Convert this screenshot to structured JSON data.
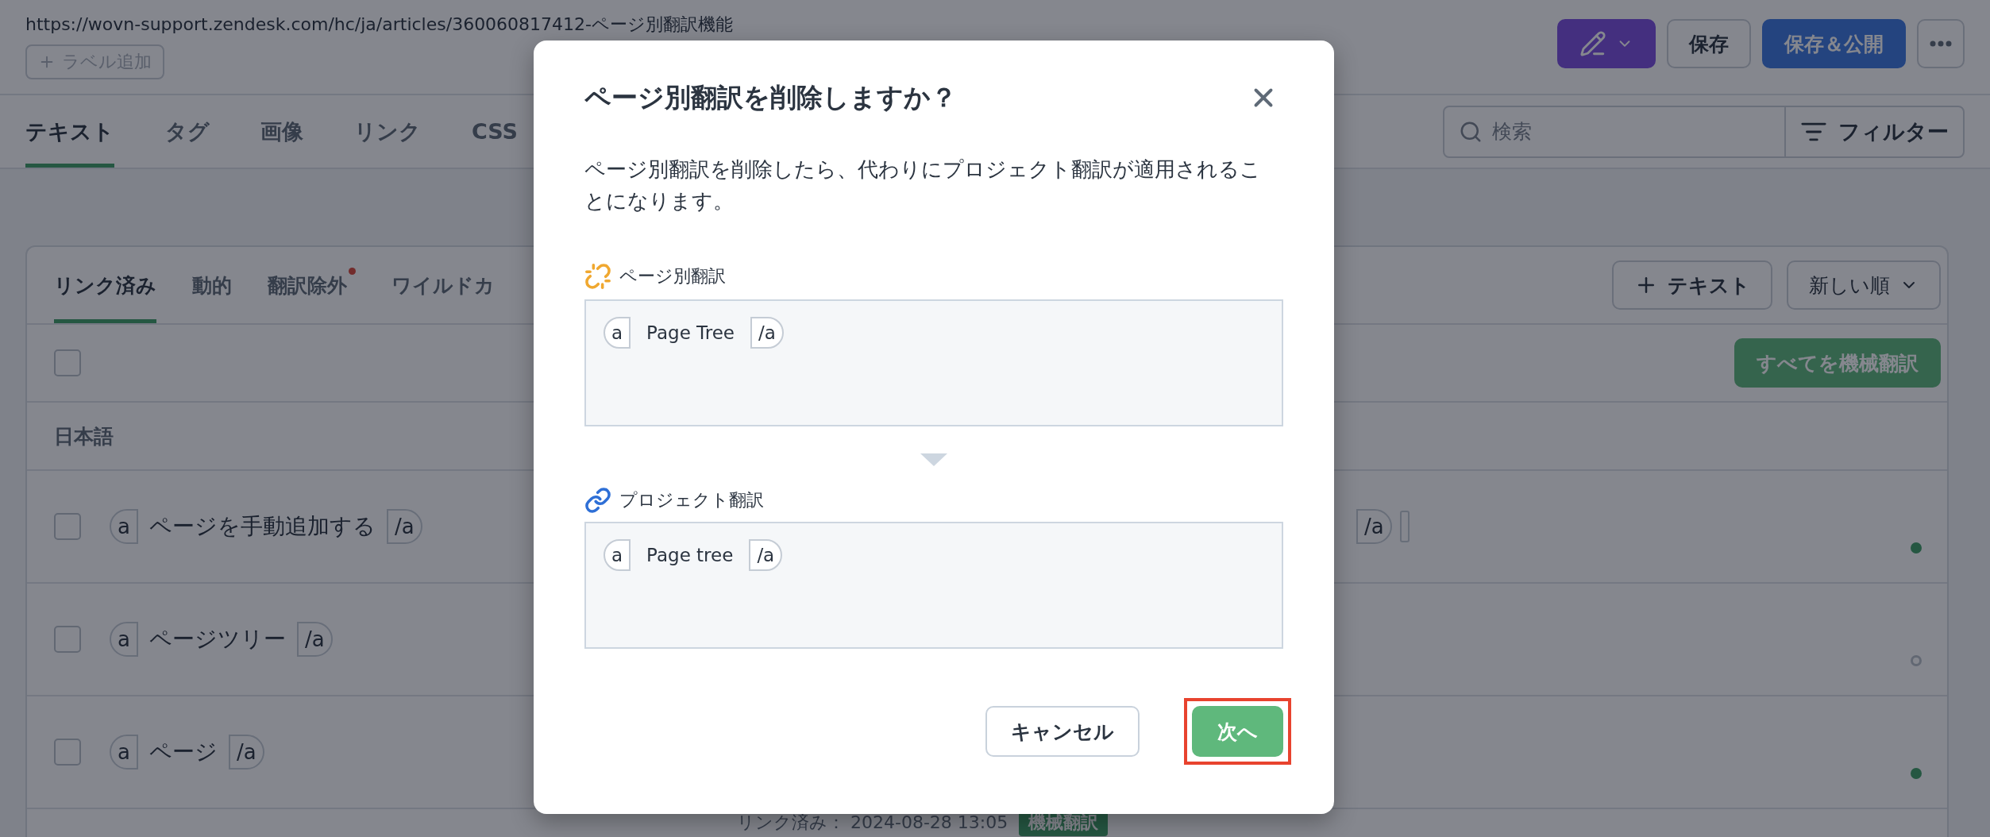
{
  "page": {
    "url": "https://wovn-support.zendesk.com/hc/ja/articles/360060817412-ページ別翻訳機能",
    "add_label_button": "ラベル追加",
    "toolbar": {
      "save_button": "保存",
      "publish_button": "保存＆公開"
    },
    "tabs": [
      {
        "label": "テキスト",
        "selected": true
      },
      {
        "label": "タグ",
        "selected": false
      },
      {
        "label": "画像",
        "selected": false
      },
      {
        "label": "リンク",
        "selected": false
      },
      {
        "label": "CSS",
        "selected": false
      }
    ],
    "search": {
      "placeholder": "検索"
    },
    "filter_button": "フィルター",
    "card": {
      "tabs": [
        {
          "label": "リンク済み",
          "selected": true,
          "badge": false
        },
        {
          "label": "動的",
          "selected": false,
          "badge": false
        },
        {
          "label": "翻訳除外",
          "selected": false,
          "badge": true
        },
        {
          "label": "ワイルドカ",
          "selected": false,
          "badge": false
        }
      ],
      "add_text_button": "テキスト",
      "sort": "新しい順",
      "machine_translate_all_button": "すべてを機械翻訳",
      "select_all_checked": false,
      "language": "日本語",
      "rows": [
        {
          "checked": false,
          "open_tag": "a",
          "source": "ページを手動追加する",
          "close_tag": "/a",
          "translation_tail": "/a",
          "done": true
        },
        {
          "checked": false,
          "open_tag": "a",
          "source": "ページツリー",
          "close_tag": "/a",
          "done": false
        },
        {
          "checked": false,
          "open_tag": "a",
          "source": "ページ",
          "close_tag": "/a",
          "done": true
        }
      ],
      "last_row": {
        "meta": "リンク済み： 2024-08-28 13:05",
        "tag": "機械翻訳"
      }
    }
  },
  "dialog": {
    "title": "ページ別翻訳を削除しますか？",
    "message": "ページ別翻訳を削除したら、代わりにプロジェクト翻訳が適用されることになります。",
    "sections": [
      {
        "kind": "page",
        "label": "ページ別翻訳",
        "open_tag": "a",
        "text": "Page Tree",
        "close_tag": "/a"
      },
      {
        "kind": "project",
        "label": "プロジェクト翻訳",
        "open_tag": "a",
        "text": "Page tree",
        "close_tag": "/a"
      }
    ],
    "cancel_button": "キャンセル",
    "next_button": "次へ",
    "next_highlighted": true
  }
}
